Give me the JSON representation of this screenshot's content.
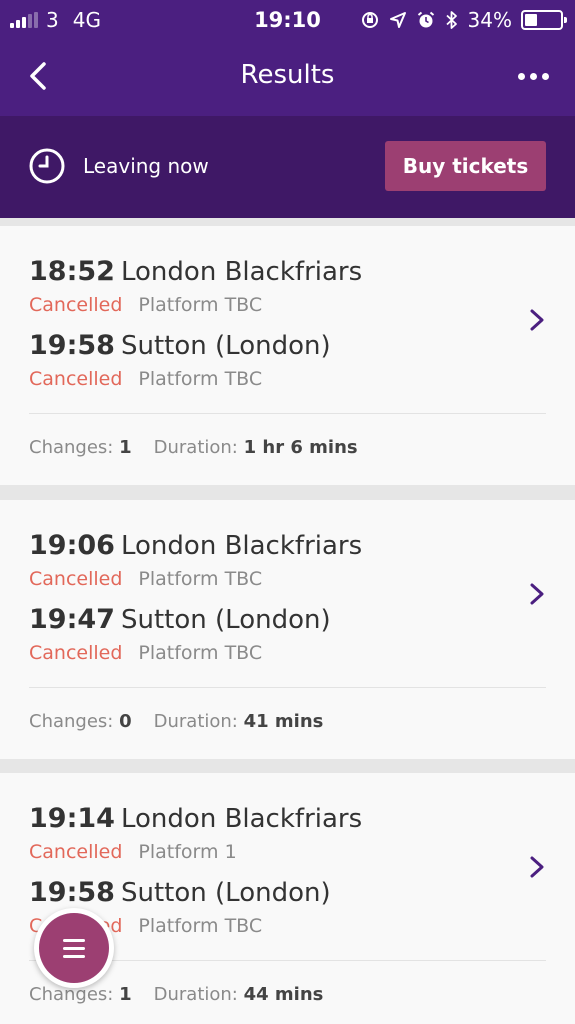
{
  "status_bar": {
    "carrier": "3",
    "network": "4G",
    "time": "19:10",
    "battery": "34%",
    "icons": [
      "orientation-lock-icon",
      "location-icon",
      "alarm-icon",
      "bluetooth-icon"
    ]
  },
  "nav": {
    "title": "Results",
    "back_icon": "chevron-left-icon",
    "more_icon": "more-dots-icon"
  },
  "subbar": {
    "leaving_label": "Leaving now",
    "buy_label": "Buy tickets"
  },
  "colors": {
    "header": "#4b1f80",
    "subbar": "#3f1866",
    "accent": "#9c3f72",
    "cancelled": "#e2685a",
    "chevron": "#4b1f80"
  },
  "labels": {
    "changes": "Changes:",
    "duration": "Duration:"
  },
  "journeys": [
    {
      "depart_time": "18:52",
      "depart_station": "London Blackfriars",
      "depart_status": "Cancelled",
      "depart_platform": "Platform TBC",
      "arrive_time": "19:58",
      "arrive_station": "Sutton (London)",
      "arrive_status": "Cancelled",
      "arrive_platform": "Platform TBC",
      "changes": "1",
      "duration": "1 hr 6 mins"
    },
    {
      "depart_time": "19:06",
      "depart_station": "London Blackfriars",
      "depart_status": "Cancelled",
      "depart_platform": "Platform TBC",
      "arrive_time": "19:47",
      "arrive_station": "Sutton (London)",
      "arrive_status": "Cancelled",
      "arrive_platform": "Platform TBC",
      "changes": "0",
      "duration": "41 mins"
    },
    {
      "depart_time": "19:14",
      "depart_station": "London Blackfriars",
      "depart_status": "Cancelled",
      "depart_platform": "Platform 1",
      "arrive_time": "19:58",
      "arrive_station": "Sutton (London)",
      "arrive_status": "Cancelled",
      "arrive_platform": "Platform TBC",
      "changes": "1",
      "duration": "44 mins"
    }
  ],
  "fab_icon": "menu-icon"
}
